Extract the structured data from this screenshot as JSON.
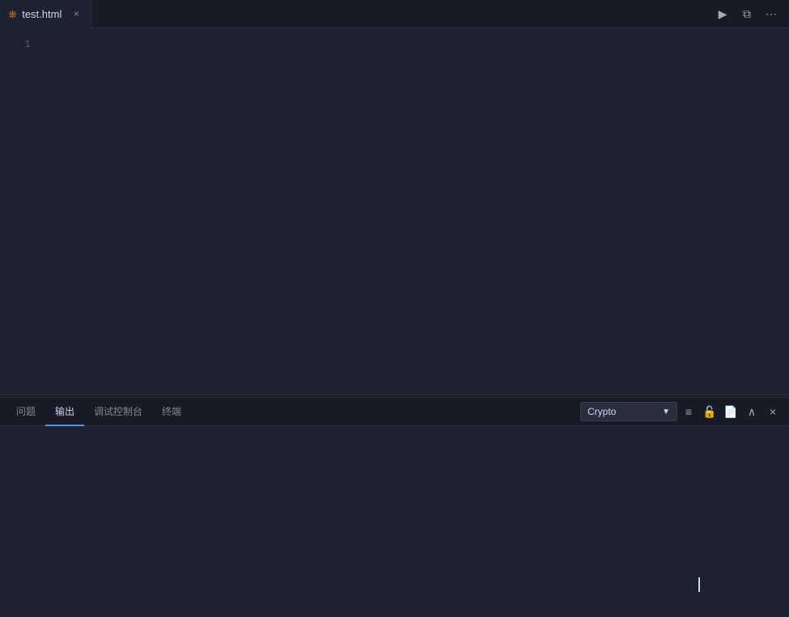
{
  "tabBar": {
    "tab": {
      "icon": "&#x2388;",
      "name": "test.html",
      "closeIcon": "×"
    },
    "actions": {
      "run": "▶",
      "split": "⧉",
      "more": "⋯"
    }
  },
  "editor": {
    "lineNumbers": [
      "1"
    ]
  },
  "bottomPanel": {
    "tabs": [
      {
        "label": "问题",
        "active": false
      },
      {
        "label": "输出",
        "active": true
      },
      {
        "label": "调试控制台",
        "active": false
      },
      {
        "label": "终端",
        "active": false
      }
    ],
    "controls": {
      "dropdown": {
        "value": "Crypto",
        "arrow": "▼"
      },
      "clearBtn": "≡",
      "lockBtn": "🔓",
      "newFileBtn": "📄",
      "collapseBtn": "∧",
      "closeBtn": "×"
    }
  }
}
